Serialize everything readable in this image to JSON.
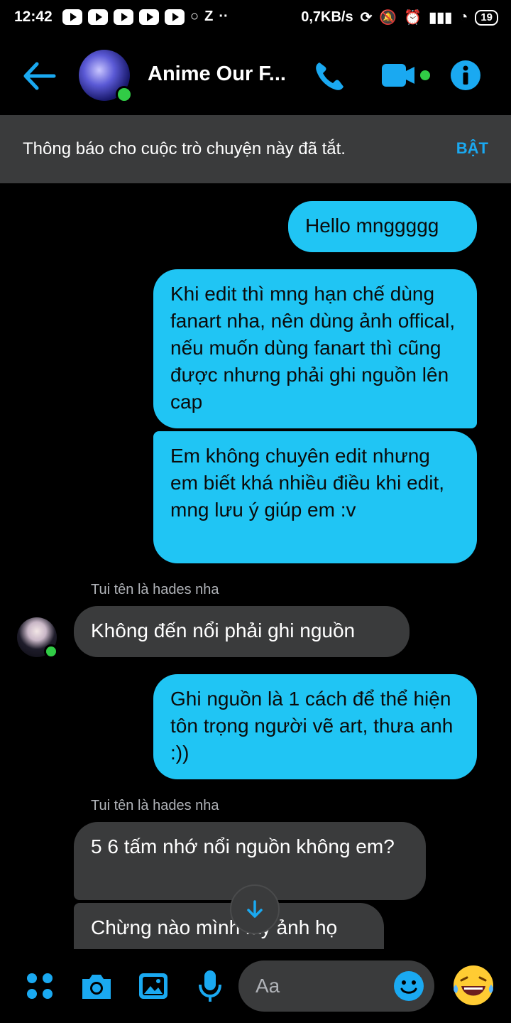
{
  "status_bar": {
    "time": "12:42",
    "net_speed": "0,7KB/s",
    "battery": "19"
  },
  "header": {
    "title": "Anime Our F...",
    "icons": [
      "back-arrow-icon",
      "avatar",
      "phone-icon",
      "video-icon",
      "info-icon"
    ],
    "accent": "#1aa9f1"
  },
  "banner": {
    "text": "Thông báo cho cuộc trò chuyện này đã tắt.",
    "button": "BẬT"
  },
  "messages": [
    {
      "from": "me",
      "text": "Hello mnggggg"
    },
    {
      "from": "me",
      "text": "Khi edit thì mng hạn chế dùng fanart nha, nên dùng ảnh offical, nếu muốn dùng fanart thì cũng được nhưng phải ghi nguồn lên cap"
    },
    {
      "from": "me",
      "text": "Em không chuyên edit nhưng em biết khá nhiều điều khi edit, mng lưu ý giúp em :v"
    },
    {
      "from": "them",
      "sender": "Tui tên là hades nha",
      "text": "Không đến nổi phải ghi nguồn"
    },
    {
      "from": "me",
      "text": "Ghi nguồn là 1 cách để thể hiện tôn trọng người vẽ art, thưa anh :))"
    },
    {
      "from": "them",
      "sender": "Tui tên là hades nha",
      "text": "5 6 tấm nhớ nổi nguồn không em?"
    },
    {
      "from": "them",
      "text": "Chừng nào mình lấy ảnh họ"
    }
  ],
  "composer": {
    "placeholder": "Aa",
    "icons": [
      "apps-icon",
      "camera-icon",
      "image-icon",
      "mic-icon",
      "emoji-icon",
      "laughing-emoji-icon"
    ]
  },
  "colors": {
    "bubble_me": "#20c5f4",
    "bubble_them": "#3a3b3c",
    "online": "#31cc46"
  }
}
